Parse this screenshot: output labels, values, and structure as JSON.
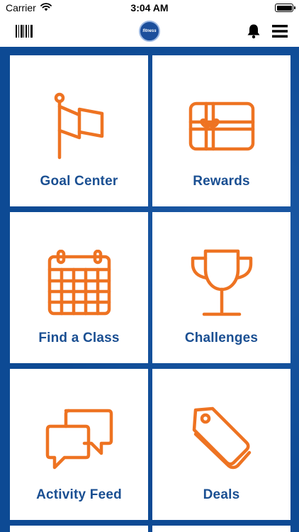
{
  "status_bar": {
    "carrier": "Carrier",
    "time": "3:04 AM"
  },
  "nav": {
    "logo_text": "fitness",
    "icons": [
      "barcode-icon",
      "bell-icon",
      "hamburger-menu-icon"
    ]
  },
  "tiles": [
    {
      "label": "Goal Center",
      "icon": "flag-icon"
    },
    {
      "label": "Rewards",
      "icon": "gift-card-icon"
    },
    {
      "label": "Find a Class",
      "icon": "calendar-icon"
    },
    {
      "label": "Challenges",
      "icon": "trophy-icon"
    },
    {
      "label": "Activity Feed",
      "icon": "chat-bubbles-icon"
    },
    {
      "label": "Deals",
      "icon": "price-tags-icon"
    }
  ],
  "colors": {
    "accent_orange": "#ee7322",
    "label_blue": "#1a4f92",
    "background_blue": "#0d4a94"
  }
}
